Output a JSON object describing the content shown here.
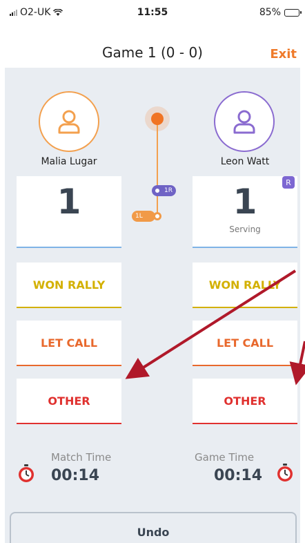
{
  "status_bar": {
    "carrier": "O2-UK",
    "time": "11:55",
    "battery": "85%"
  },
  "header": {
    "title": "Game 1 (0 - 0)",
    "exit_label": "Exit"
  },
  "players": {
    "left": {
      "name": "Malia Lugar",
      "score": "1"
    },
    "right": {
      "name": "Leon Watt",
      "score": "1",
      "status": "Serving",
      "badge": "R"
    }
  },
  "timeline": {
    "right_tag": "1R",
    "left_tag": "1L"
  },
  "buttons": {
    "won_rally": "WON RALLY",
    "let_call": "LET CALL",
    "other": "OTHER"
  },
  "timers": {
    "match_label": "Match Time",
    "match_value": "00:14",
    "game_label": "Game Time",
    "game_value": "00:14"
  },
  "undo_label": "Undo",
  "colors": {
    "accent_orange": "#ef7a2a",
    "player_left": "#f3a04e",
    "player_right": "#8a6bd0",
    "won": "#d3b000",
    "let": "#e8682c",
    "other": "#e0312f",
    "annotation_arrow": "#b0192a"
  }
}
